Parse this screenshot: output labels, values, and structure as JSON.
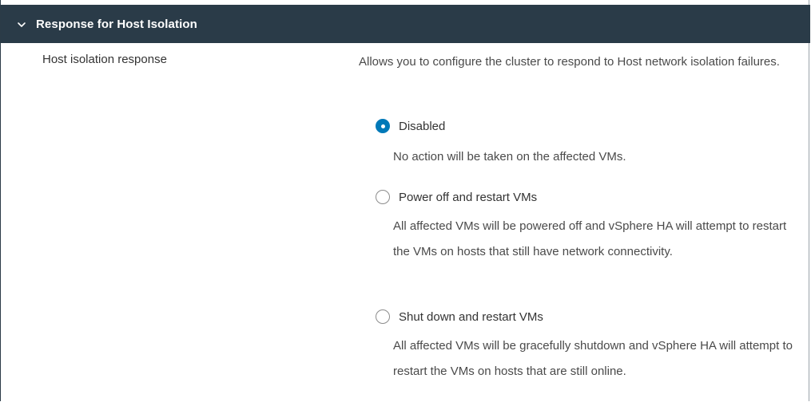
{
  "section": {
    "title": "Response for Host Isolation",
    "expanded": true
  },
  "setting": {
    "label": "Host isolation response",
    "description": "Allows you to configure the cluster to respond to Host network isolation failures."
  },
  "options": [
    {
      "label": "Disabled",
      "description": "No action will be taken on the affected VMs.",
      "selected": true
    },
    {
      "label": "Power off and restart VMs",
      "description": "All affected VMs will be powered off and vSphere HA will attempt to restart the VMs on hosts that still have network connectivity.",
      "selected": false
    },
    {
      "label": "Shut down and restart VMs",
      "description": "All affected VMs will be gracefully shutdown and vSphere HA will attempt to restart the VMs on hosts that are still online.",
      "selected": false
    }
  ],
  "colors": {
    "header_bg": "#2a3b48",
    "radio_selected": "#0079b8"
  },
  "icons": {
    "header_toggle": "chevron-down-icon"
  }
}
